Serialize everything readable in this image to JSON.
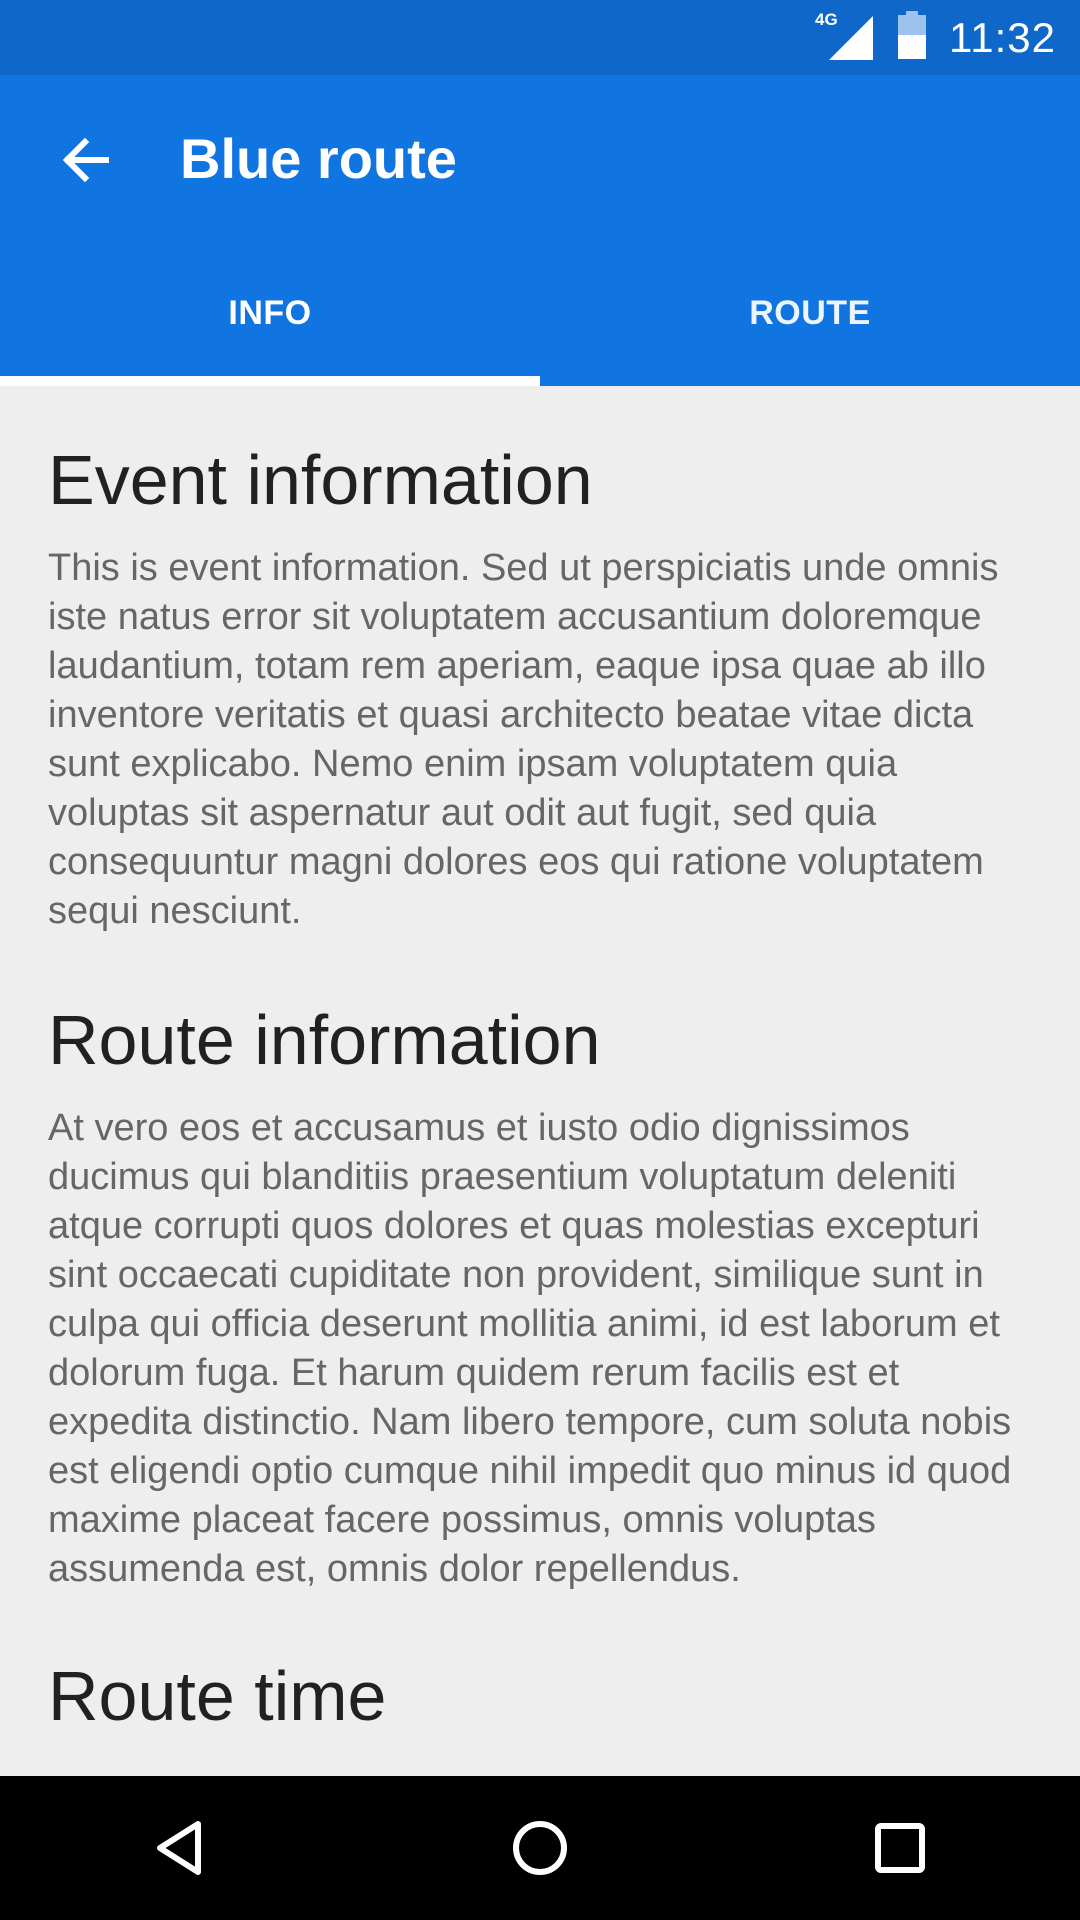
{
  "status_bar": {
    "time": "11:32",
    "network": "4G",
    "icons": [
      "signal-icon",
      "battery-icon"
    ]
  },
  "app_bar": {
    "title": "Blue route",
    "back_icon": "arrow-left-icon",
    "color": "#1075e0"
  },
  "tabs": [
    {
      "label": "INFO",
      "selected": true
    },
    {
      "label": "ROUTE",
      "selected": false
    }
  ],
  "sections": [
    {
      "heading": "Event information",
      "body": "This is event information. Sed ut perspiciatis unde omnis iste natus error sit voluptatem accusantium doloremque laudantium, totam rem aperiam, eaque ipsa quae ab illo inventore veritatis et quasi architecto beatae vitae dicta sunt explicabo. Nemo enim ipsam voluptatem quia voluptas sit aspernatur aut odit aut fugit, sed quia consequuntur magni dolores eos qui ratione voluptatem sequi nesciunt."
    },
    {
      "heading": "Route information",
      "body": "At vero eos et accusamus et iusto odio dignissimos ducimus qui blanditiis praesentium voluptatum deleniti atque corrupti quos dolores et quas molestias excepturi sint occaecati cupiditate non provident, similique sunt in culpa qui officia deserunt mollitia animi, id est laborum et dolorum fuga. Et harum quidem rerum facilis est et expedita distinctio. Nam libero tempore, cum soluta nobis est eligendi optio cumque nihil impedit quo minus id quod maxime placeat facere possimus, omnis voluptas assumenda est, omnis dolor repellendus."
    },
    {
      "heading": "Route time"
    }
  ],
  "nav_bar": {
    "buttons": [
      "back-triangle-icon",
      "home-circle-icon",
      "recents-square-icon"
    ]
  }
}
